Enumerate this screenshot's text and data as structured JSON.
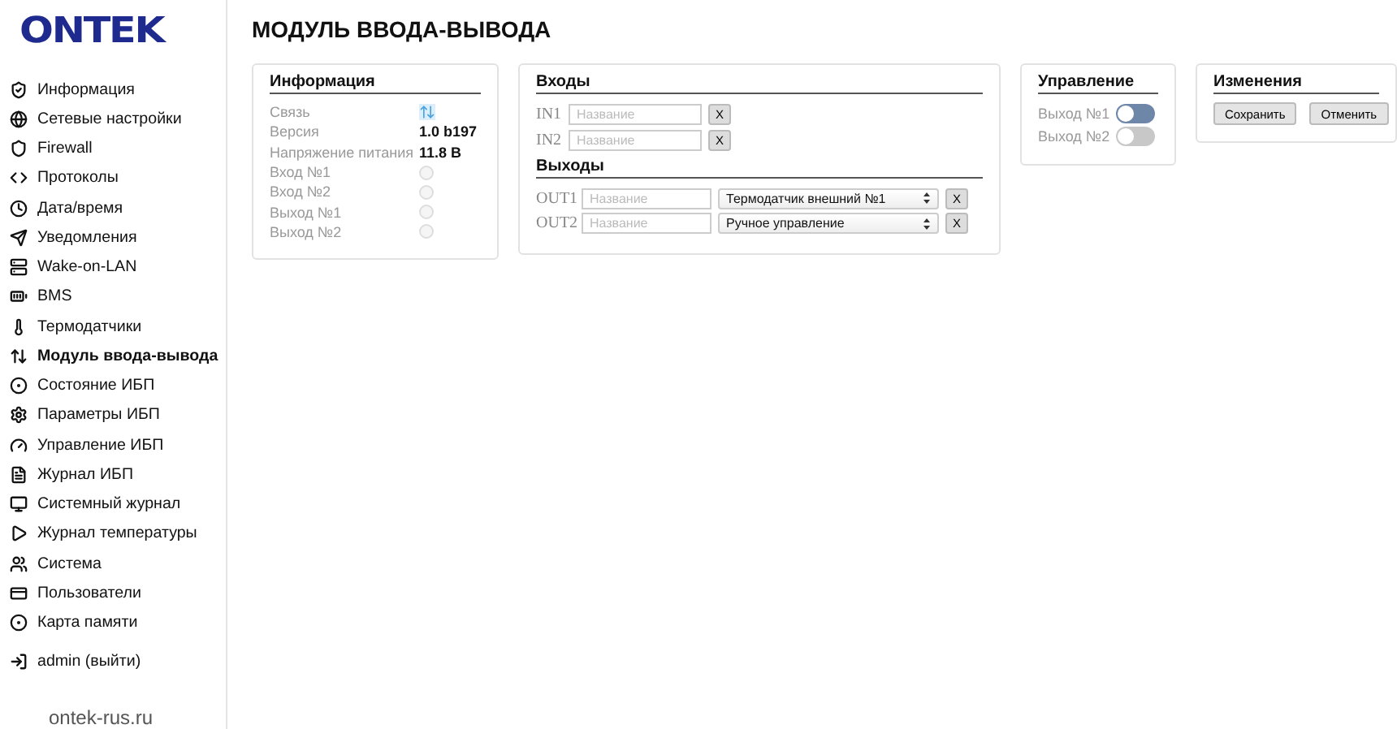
{
  "logo": "ONTEK",
  "sidebar": {
    "items": [
      {
        "label": "Информация",
        "selected": false
      },
      {
        "label": "Сетевые настройки",
        "selected": false
      },
      {
        "label": "Firewall",
        "selected": false
      },
      {
        "label": "Протоколы",
        "selected": false
      },
      {
        "label": "Дата/время",
        "selected": false
      },
      {
        "label": "Уведомления",
        "selected": false
      },
      {
        "label": "Wake-on-LAN",
        "selected": false
      },
      {
        "label": "BMS",
        "selected": false
      },
      {
        "label": "Термодатчики",
        "selected": false
      },
      {
        "label": "Модуль ввода-вывода",
        "selected": true
      },
      {
        "label": "Состояние ИБП",
        "selected": false
      },
      {
        "label": "Параметры ИБП",
        "selected": false
      },
      {
        "label": "Управление ИБП",
        "selected": false
      },
      {
        "label": "Журнал ИБП",
        "selected": false
      },
      {
        "label": "Системный журнал",
        "selected": false
      },
      {
        "label": "Журнал температуры",
        "selected": false
      },
      {
        "label": "Система",
        "selected": false
      },
      {
        "label": "Пользователи",
        "selected": false
      },
      {
        "label": "Карта памяти",
        "selected": false
      }
    ],
    "logout": "admin (выйти)",
    "site": "ontek-rus.ru"
  },
  "page_title": "МОДУЛЬ ВВОДА-ВЫВОДА",
  "info": {
    "title": "Информация",
    "rows": [
      {
        "label": "Связь",
        "kind": "link"
      },
      {
        "label": "Версия",
        "kind": "text",
        "value": "1.0 b197"
      },
      {
        "label": "Напряжение питания",
        "kind": "text",
        "value": "11.8 В"
      },
      {
        "label": "Вход №1",
        "kind": "led",
        "on": false
      },
      {
        "label": "Вход №2",
        "kind": "led",
        "on": false
      },
      {
        "label": "Выход №1",
        "kind": "led",
        "on": false
      },
      {
        "label": "Выход №2",
        "kind": "led",
        "on": false
      }
    ]
  },
  "inputs": {
    "title": "Входы",
    "rows": [
      {
        "label": "IN1",
        "placeholder": "Название",
        "clear": "X"
      },
      {
        "label": "IN2",
        "placeholder": "Название",
        "clear": "X"
      }
    ]
  },
  "outputs": {
    "title": "Выходы",
    "rows": [
      {
        "label": "OUT1",
        "placeholder": "Название",
        "source": "Термодатчик внешний №1",
        "clear": "X"
      },
      {
        "label": "OUT2",
        "placeholder": "Название",
        "source": "Ручное управление",
        "clear": "X"
      }
    ]
  },
  "control": {
    "title": "Управление",
    "rows": [
      {
        "label": "Выход №1",
        "color": "#6e87a8"
      },
      {
        "label": "Выход №2",
        "color": "#c8c8c8"
      }
    ]
  },
  "changes": {
    "title": "Изменения",
    "buttons": [
      "Сохранить",
      "Отменить"
    ]
  }
}
